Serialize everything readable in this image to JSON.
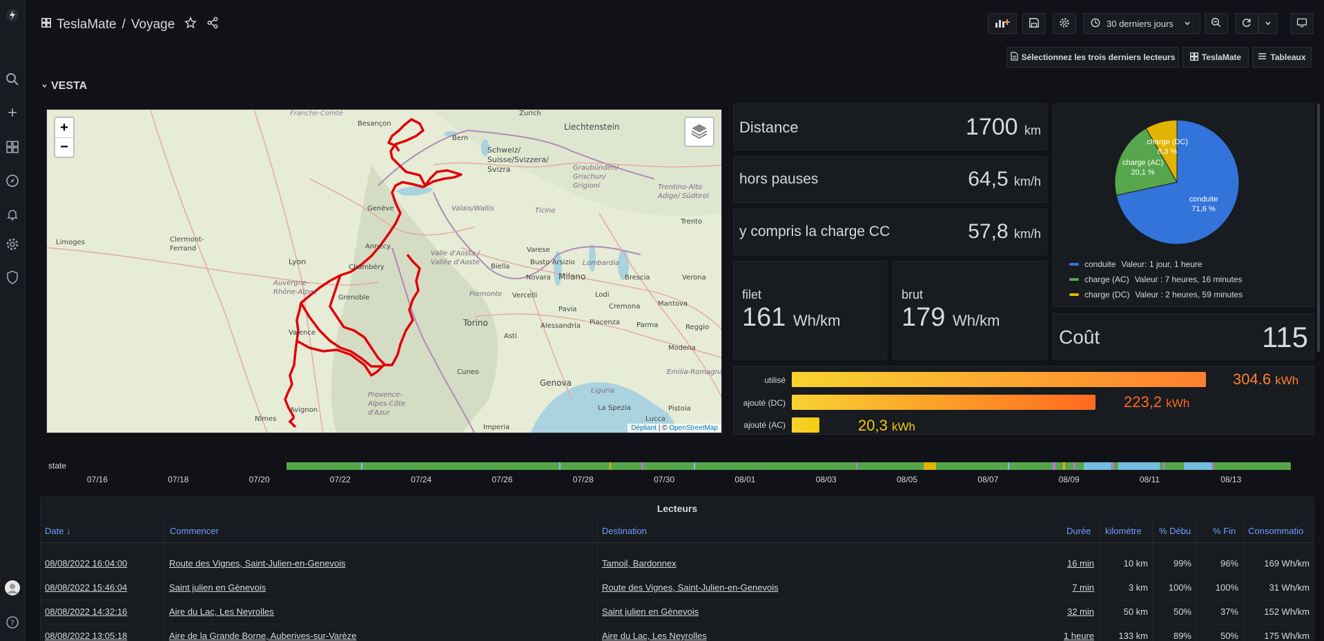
{
  "breadcrumb": {
    "app": "TeslaMate",
    "separator": "/",
    "page": "Voyage"
  },
  "toolbar": {
    "time_range": "30 derniers jours",
    "select_last_button": "Sélectionnez les trois derniers lecteurs",
    "teslamate_button": "TeslaMate",
    "tableaux_button": "Tableaux"
  },
  "row_title": "VESTA",
  "stats": {
    "distance": {
      "label": "Distance",
      "value": "1700",
      "unit": "km"
    },
    "hors_pauses": {
      "label": "hors pauses",
      "value": "64,5",
      "unit": "km/h"
    },
    "charge_cc": {
      "label": "y compris la charge CC",
      "value": "57,8",
      "unit": "km/h"
    },
    "filet": {
      "label": "filet",
      "value": "161",
      "unit": "Wh/km"
    },
    "brut": {
      "label": "brut",
      "value": "179",
      "unit": "Wh/km"
    },
    "cout": {
      "label": "Coût",
      "value": "115"
    }
  },
  "pie": {
    "slices": [
      {
        "name": "conduite",
        "label": "conduite",
        "pct": "71,6 %",
        "value": 71.6,
        "color": "#3274d9",
        "legend": "Valeur: 1 jour, 1 heure"
      },
      {
        "name": "charge (AC)",
        "label": "charge (AC)",
        "pct": "20,1 %",
        "value": 20.1,
        "color": "#56a64b",
        "legend": "Valeur : 7 heures, 16 minutes"
      },
      {
        "name": "charge (DC)",
        "label": "charge (DC)",
        "pct": "8,3 %",
        "value": 8.3,
        "color": "#e0b400",
        "legend": "Valeur : 2 heures, 59 minutes"
      }
    ]
  },
  "energy": {
    "used": {
      "label": "utilisé",
      "value": "304.6",
      "unit": "kWh",
      "num": 304.6,
      "color": "#ff7f30"
    },
    "dc": {
      "label": "ajouté (DC)",
      "value": "223,2",
      "unit": "kWh",
      "num": 223.2,
      "color": "#ff7f30"
    },
    "ac": {
      "label": "ajouté (AC)",
      "value": "20,3",
      "unit": "kWh",
      "num": 20.3,
      "color": "#f2cc0c"
    }
  },
  "map": {
    "labels": [
      "Franche-Comté",
      "Besançon",
      "Zurich",
      "Liechtenstein",
      "Bern",
      "Schweiz/ Suisse/Svizzera/ Svizra",
      "Graubünden/ Grischun/ Grigioni",
      "Trentino-Alto Adige/ Südtirol",
      "Valais/Wallis",
      "Ticino",
      "Limoges",
      "Clermont-Ferrand",
      "Auvergne-Rhône-Alpes",
      "Lyon",
      "Genève",
      "Annecy",
      "Chambéry",
      "Grenoble",
      "Valence",
      "Valle d'Aosta / Vallée d'Aoste",
      "Varese",
      "Busto Arsizio",
      "Biella",
      "Novara",
      "Milano",
      "Lombardia",
      "Brescia",
      "Verona",
      "Trento",
      "Vercelli",
      "Pavia",
      "Lodi",
      "Cremona",
      "Mantova",
      "Piemonte",
      "Torino",
      "Alessandria",
      "Piacenza",
      "Parma",
      "Asti",
      "Modena",
      "Reggio",
      "Cuneo",
      "Genova",
      "Liguria",
      "La Spezia",
      "Provence-Alpes-Côte d'Azur",
      "Avignon",
      "Nîmes",
      "Imperia",
      "Lucca",
      "Pistoia",
      "Emilia-Romagna"
    ],
    "attribution_link": "Dépliant",
    "attribution_sep": "|",
    "attribution_copy": "©",
    "attribution_osm": "OpenStreetMap",
    "zoom_in": "+",
    "zoom_out": "−"
  },
  "timeline": {
    "label": "state",
    "ticks": [
      "07/16",
      "07/18",
      "07/20",
      "07/22",
      "07/24",
      "07/26",
      "07/28",
      "07/30",
      "08/01",
      "08/03",
      "08/05",
      "08/07",
      "08/09",
      "08/11",
      "08/13"
    ]
  },
  "table": {
    "title": "Lecteurs",
    "columns": [
      "Date",
      "Commencer",
      "Destination",
      "Durée",
      "kilomètre",
      "% Débu",
      "% Fin",
      "Consommatio"
    ],
    "rows": [
      [
        "08/08/2022 16:04:00",
        "Route des Vignes, Saint-Julien-en-Genevois",
        "Tamoil, Bardonnex",
        "16 min",
        "10 km",
        "99%",
        "96%",
        "169 Wh/km"
      ],
      [
        "08/08/2022 15:46:04",
        "Saint julien en Gènevois",
        "Route des Vignes, Saint-Julien-en-Genevois",
        "7 min",
        "3 km",
        "100%",
        "100%",
        "31 Wh/km"
      ],
      [
        "08/08/2022 14:32:16",
        "Aire du Lac, Les Neyrolles",
        "Saint julien en Gènevois",
        "32 min",
        "50 km",
        "50%",
        "37%",
        "152 Wh/km"
      ],
      [
        "08/08/2022 13:05:18",
        "Aire de la Grande Borne, Auberives-sur-Varèze",
        "Aire du Lac, Les Neyrolles",
        "1 heure",
        "133 km",
        "89%",
        "50%",
        "175 Wh/km"
      ]
    ]
  },
  "colors": {
    "accent": "#6e9fff",
    "bg": "#111217",
    "panel": "#181b1f",
    "route": "#e0000a"
  }
}
